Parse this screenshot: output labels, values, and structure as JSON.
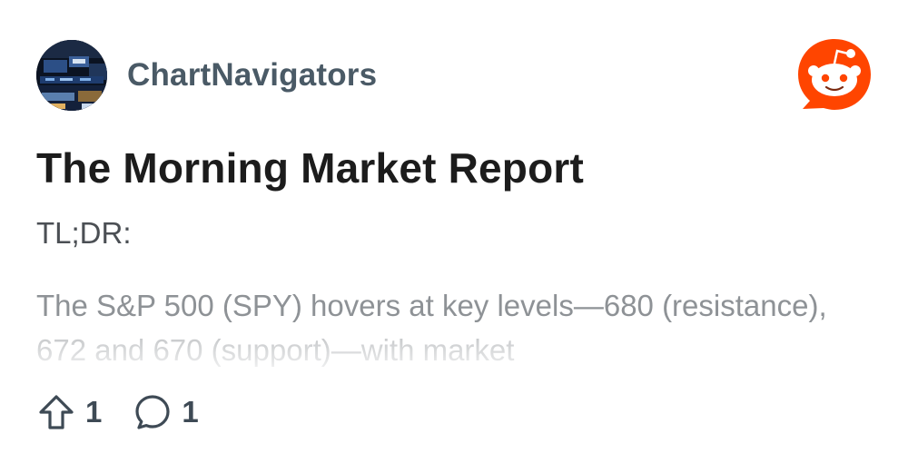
{
  "post": {
    "author": "ChartNavigators",
    "title": "The Morning Market Report",
    "tldr_label": "TL;DR:",
    "body": "The S&P 500 (SPY) hovers at key levels—680 (resistance), 672 and 670 (support)—with market"
  },
  "stats": {
    "upvotes": "1",
    "comments": "1"
  },
  "icons": {
    "avatar": "stock-exchange-avatar",
    "logo": "reddit-logo-icon",
    "upvote": "upvote-arrow-icon",
    "comment": "comment-bubble-icon"
  },
  "colors": {
    "brand": "#FF4500",
    "author_text": "#4a5a66",
    "title_text": "#1c1c1c",
    "muted_text": "#8e9296"
  }
}
